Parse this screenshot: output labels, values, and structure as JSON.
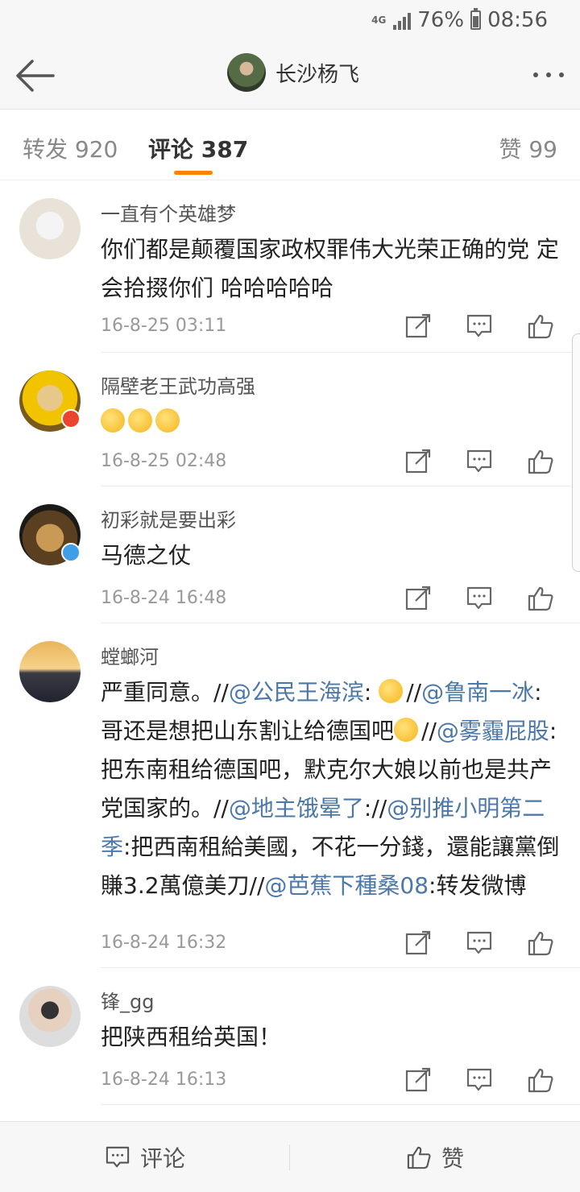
{
  "status_bar": {
    "network": "4G",
    "battery_percent": "76%",
    "time": "08:56"
  },
  "header": {
    "title": "长沙杨飞"
  },
  "tabs": {
    "repost": "转发 920",
    "comment": "评论 387",
    "like": "赞 99"
  },
  "comments": [
    {
      "user": "一直有个英雄梦",
      "text": "你们都是颠覆国家政权罪伟大光荣正确的党 定会拾掇你们 哈哈哈哈哈",
      "time": "16-8-25 03:11"
    },
    {
      "user": "隔壁老王武功高强",
      "time": "16-8-25 02:48"
    },
    {
      "user": "初彩就是要出彩",
      "text": "马德之仗",
      "time": "16-8-24 16:48"
    },
    {
      "user": "螳螂河",
      "parts": {
        "p1": "严重同意。//",
        "l1": "@公民王海滨",
        "p2": ": ",
        "p3": "//",
        "l2": "@鲁南一冰",
        "p4": ": 哥还是想把山东割让给德国吧",
        "p5": "//",
        "l3": "@雾霾屁股",
        "p6": ": 把东南租给德国吧，默克尔大娘以前也是共产党国家的。//",
        "l4": "@地主饿晕了",
        "p7": "://",
        "l5": "@别推小明第二季",
        "p8": ":把西南租給美國，不花一分錢，還能讓黨倒賺3.2萬億美刀//",
        "l6": "@芭蕉下種桑08",
        "p9": ":转发微博"
      },
      "time": "16-8-24 16:32"
    },
    {
      "user": "锋_gg",
      "text": "把陕西租给英国！",
      "time": "16-8-24 16:13"
    }
  ],
  "bottom_bar": {
    "comment_label": "评论",
    "like_label": "赞"
  },
  "colors": {
    "accent": "#ff8200",
    "link": "#4b78a8"
  },
  "icons": [
    "back-arrow-icon",
    "more-dots-icon",
    "repost-icon",
    "reply-icon",
    "like-icon",
    "comment-icon"
  ]
}
